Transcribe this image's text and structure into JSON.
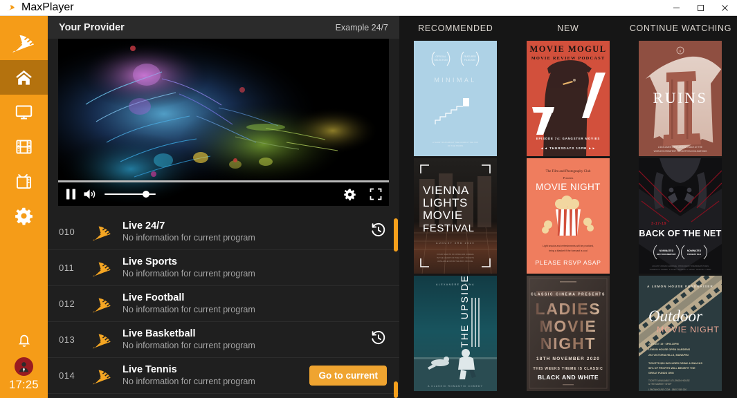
{
  "window": {
    "title": "MaxPlayer",
    "logo_icon": "satellite-dish-icon",
    "minimize_label": "Minimize",
    "maximize_label": "Maximize",
    "close_label": "Close"
  },
  "sidebar": {
    "brand_icon": "satellite-dish-icon",
    "items": [
      {
        "icon": "home-icon",
        "label": "Home",
        "active": true
      },
      {
        "icon": "monitor-icon",
        "label": "Live TV",
        "active": false
      },
      {
        "icon": "film-strip-icon",
        "label": "Movies",
        "active": false
      },
      {
        "icon": "tv-icon",
        "label": "Series",
        "active": false
      },
      {
        "icon": "gear-icon",
        "label": "Settings",
        "active": false
      }
    ],
    "notifications_icon": "bell-icon",
    "avatar_icon": "user-avatar-icon",
    "clock": "17:25"
  },
  "player": {
    "provider_title": "Your Provider",
    "provider_subtitle": "Example 24/7",
    "progress_percent": 100,
    "volume_percent": 76,
    "controls": {
      "pause_label": "Pause",
      "volume_label": "Volume",
      "settings_label": "Settings",
      "fullscreen_label": "Fullscreen"
    }
  },
  "channels": {
    "no_info_text": "No information for current program",
    "go_to_current_label": "Go to current",
    "rows": [
      {
        "number": "010",
        "title": "Live 24/7",
        "desc": "No information for current program",
        "action": "history"
      },
      {
        "number": "011",
        "title": "Live Sports",
        "desc": "No information for current program",
        "action": "none"
      },
      {
        "number": "012",
        "title": "Live Football",
        "desc": "No information for current program",
        "action": "none"
      },
      {
        "number": "013",
        "title": "Live Basketball",
        "desc": "No information for current program",
        "action": "history"
      },
      {
        "number": "014",
        "title": "Live Tennis",
        "desc": "No information for current program",
        "action": "goto"
      }
    ]
  },
  "rails": [
    {
      "heading": "RECOMMENDED",
      "posters": [
        {
          "id": "poster-stairs-door",
          "style": "light-blue-minimal",
          "bg": "#aed2e6",
          "lines": [
            "OFFICIAL SELECTION",
            "FEATURED FILM",
            "MINIMAL",
            "A SHORT FILM ABOUT THE DOOR AT THE TOP OF THE STAIRS"
          ]
        },
        {
          "id": "poster-vienna-lights",
          "style": "dark-photo-frame",
          "bg": "#1a1613",
          "lines": [
            "VIENNA",
            "LIGHTS",
            "MOVIE",
            "FESTIVAL",
            "AUGUST 3RD  2020",
            "FOUR NIGHTS OF OPEN AIR CINEMA IN THE HEART OF THE CITY"
          ]
        },
        {
          "id": "poster-the-upside",
          "style": "teal-photo",
          "bg": "#14424a",
          "lines": [
            "ALEXANDRE  ·  NINA",
            "THE UPSIDE",
            "A CLASSIC ROMANTIC COMEDY"
          ]
        }
      ]
    },
    {
      "heading": "NEW",
      "posters": [
        {
          "id": "poster-movie-mogul",
          "style": "red-silhouette",
          "bg": "#d2503c",
          "lines": [
            "MOVIE MOGUL",
            "MOVIE REVIEW PODCAST",
            "74",
            "EPISODE 74: GANGSTER MOVIES",
            "THURSDAYS 10PM"
          ]
        },
        {
          "id": "poster-movie-night-popcorn",
          "style": "orange-popcorn",
          "bg": "#ef7d5e",
          "lines": [
            "The Film and Photography Club",
            "Presents",
            "MOVIE NIGHT",
            "Light snacks and refreshments will be provided, bring a blanket if the forecast is cool",
            "PLEASE RSVP ASAP"
          ]
        },
        {
          "id": "poster-ladies-movie-night",
          "style": "brown-typographic",
          "bg": "#3b3330",
          "lines": [
            "CLASSIC CINEMA PRESENTS",
            "LADIES",
            "MOVIE",
            "NIGHT",
            "18TH NOVEMBER 2020",
            "THIS WEEKS THEME IS CLASSIC",
            "BLACK AND WHITE"
          ]
        }
      ]
    },
    {
      "heading": "CONTINUE WATCHING",
      "posters": [
        {
          "id": "poster-ruins",
          "style": "sepia-ruins",
          "bg": "#b9776a",
          "lines": [
            "RUINS",
            "A DOCUMENTARY LOOKING BACK AT THE WORLD'S GREATEST FORGOTTEN CIVILISATIONS"
          ]
        },
        {
          "id": "poster-back-of-the-net",
          "style": "dark-sports",
          "bg": "#131316",
          "lines": [
            "3-17-19",
            "BACK OF THE NET",
            "NOMINATED BEST DOCUMENTARY",
            "NOMINATED FOR BEST FILM"
          ]
        },
        {
          "id": "poster-outdoor-movie-night",
          "style": "dark-teal-filmstrip",
          "bg": "#2b3b3f",
          "lines": [
            "A LEMON HOUSE FUNDRAISER",
            "Outdoor",
            "MOVIE NIGHT",
            "AUGUST 19  ·  6PM-10PM",
            "LEMON HOUSE OPEN GARDENS",
            "292 VICTORIA HILLS, MANAPIKI",
            "TICKETS $20 INCLUDES DRINK & SNACKS",
            "50% OF PROFITS WILL BENEFIT THE GREAT FUNDS ORG",
            "TICKETS AVAILABLE AT LEMON HOUSE",
            "& THE MARKET SHOP",
            "LEMONHOUSE.COM",
            "0800 2345 000"
          ]
        }
      ]
    }
  ],
  "colors": {
    "brand_orange": "#f59c18",
    "brand_orange_active": "#b4720e",
    "button_orange": "#efa430",
    "panel_dark": "#1f1f1f",
    "right_panel_dark": "#161616",
    "header_dark": "#2b2b2b"
  }
}
